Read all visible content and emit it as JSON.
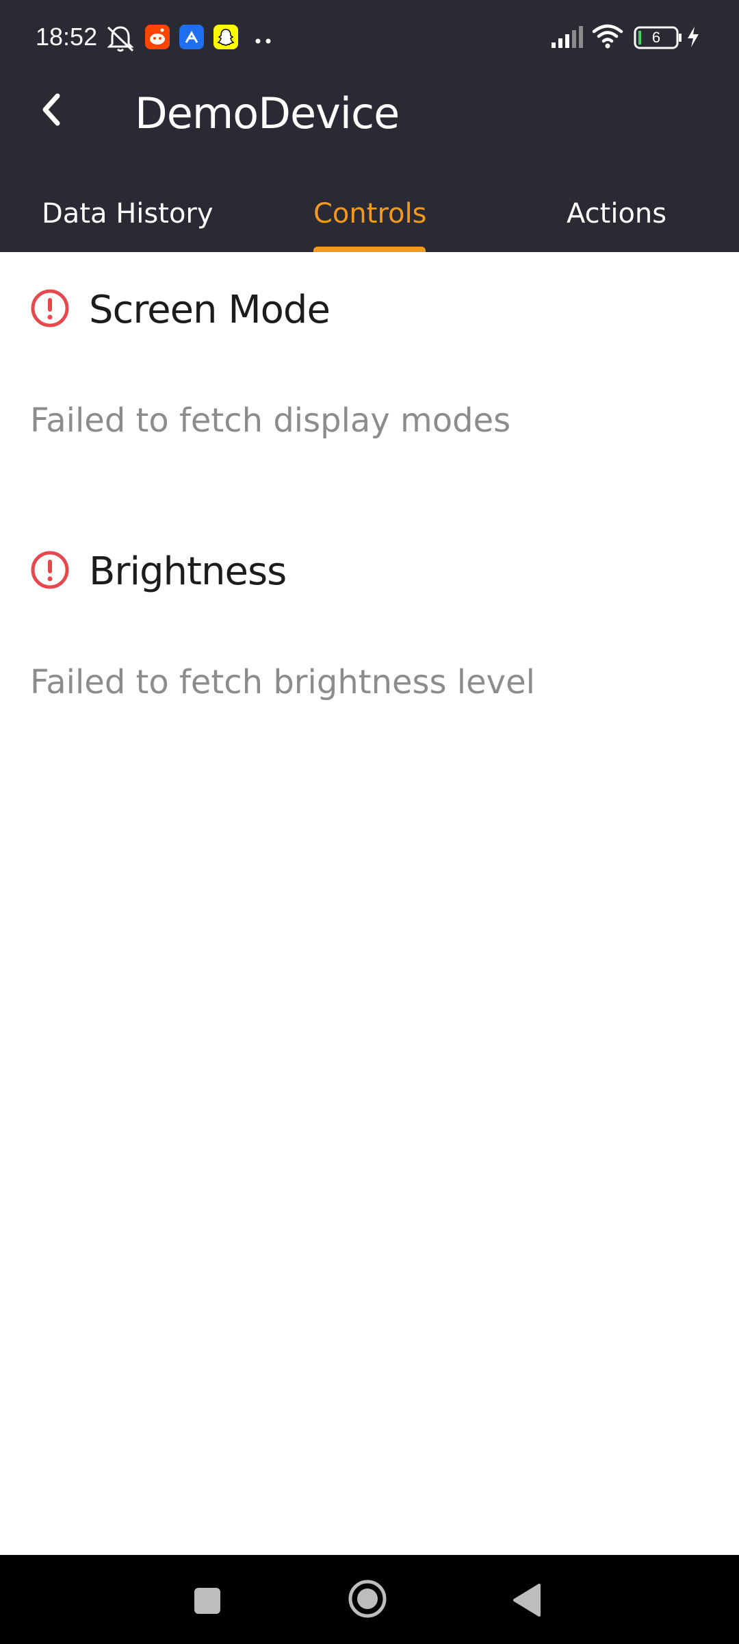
{
  "status_bar": {
    "time": "18:52",
    "battery_level": "6",
    "icons": [
      "mute-icon",
      "reddit-icon",
      "app-icon",
      "snapchat-icon",
      "more-dots-icon",
      "signal-icon",
      "wifi-icon",
      "battery-icon",
      "charging-icon"
    ]
  },
  "app_bar": {
    "title": "DemoDevice",
    "back_icon": "chevron-left-icon"
  },
  "tabs": [
    {
      "label": "Data History",
      "active": false
    },
    {
      "label": "Controls",
      "active": true
    },
    {
      "label": "Actions",
      "active": false
    }
  ],
  "sections": [
    {
      "title": "Screen Mode",
      "message": "Failed to fetch display modes",
      "icon": "error-icon"
    },
    {
      "title": "Brightness",
      "message": "Failed to fetch brightness level",
      "icon": "error-icon"
    }
  ],
  "nav_bar": {
    "icons": [
      "recents-icon",
      "home-icon",
      "back-icon"
    ]
  },
  "colors": {
    "header_bg": "#2a2a35",
    "accent": "#f39a1e",
    "error": "#e5484d",
    "muted_text": "#8c8c8c"
  }
}
